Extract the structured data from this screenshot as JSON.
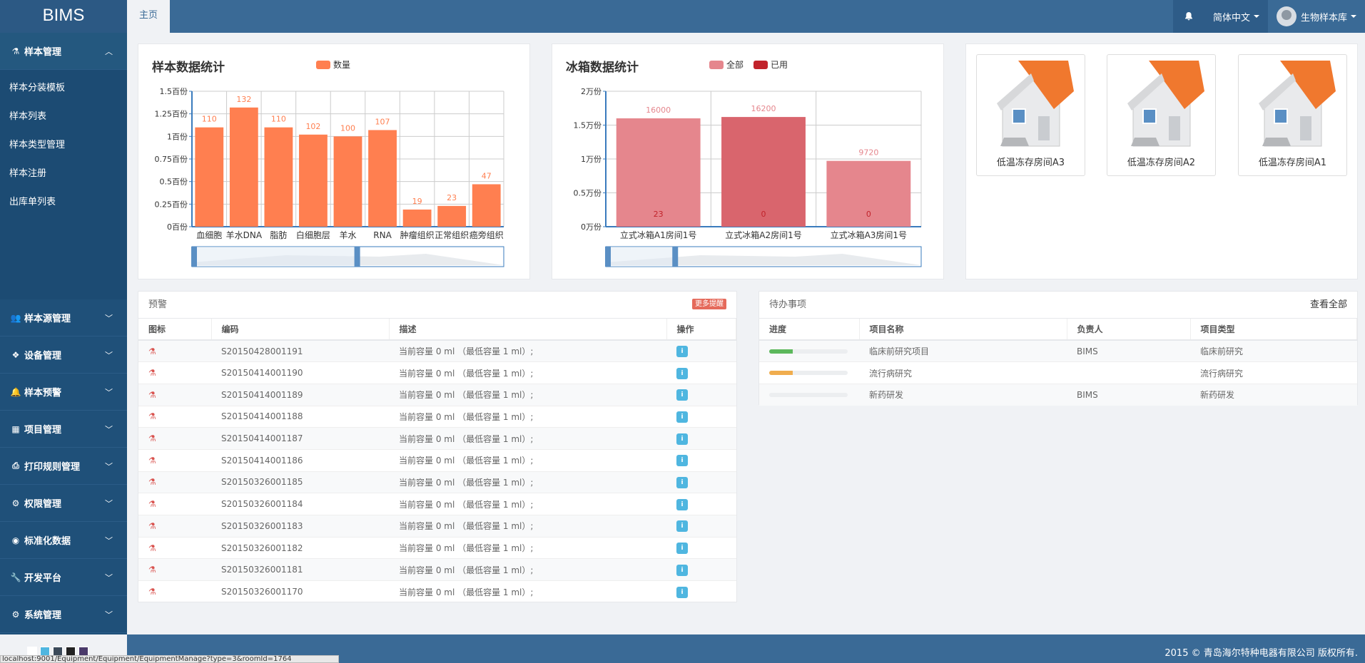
{
  "app": {
    "logo": "BIMS",
    "home_tab": "主页",
    "language": "简体中文",
    "user": "生物样本库",
    "footer": "2015 © 青岛海尔特种电器有限公司 版权所有."
  },
  "sidebar": {
    "open_menu": {
      "label": "样本管理",
      "icon": "flask-icon",
      "children": [
        "样本分装模板",
        "样本列表",
        "样本类型管理",
        "样本注册",
        "出库单列表"
      ]
    },
    "menus": [
      {
        "label": "样本源管理",
        "icon": "users-icon"
      },
      {
        "label": "设备管理",
        "icon": "dropbox-icon"
      },
      {
        "label": "样本预警",
        "icon": "bell-icon"
      },
      {
        "label": "项目管理",
        "icon": "table-icon"
      },
      {
        "label": "打印规则管理",
        "icon": "print-icon"
      },
      {
        "label": "权限管理",
        "icon": "gear-icon"
      },
      {
        "label": "标准化数据",
        "icon": "eye-icon"
      },
      {
        "label": "开发平台",
        "icon": "wrench-icon"
      },
      {
        "label": "系统管理",
        "icon": "cogs-icon"
      }
    ],
    "skins": [
      "#ffffff",
      "#4fb6e0",
      "#3c4a5a",
      "#222222",
      "#4a3a6a"
    ]
  },
  "status_url": "localhost:9001/Equipment/Equipment/EquipmentManage?type=3&roomId=1764",
  "sample_panel": {
    "title": "样本数据统计",
    "chart_data": {
      "type": "bar",
      "categories": [
        "血细胞",
        "羊水DNA",
        "脂肪",
        "白细胞层",
        "羊水",
        "RNA",
        "肿瘤组织",
        "正常组织",
        "癌旁组织"
      ],
      "series": [
        {
          "name": "数量",
          "values": [
            110,
            132,
            110,
            102,
            100,
            107,
            19,
            23,
            47
          ],
          "color": "#ff7f50"
        }
      ],
      "yticks": [
        "0百份",
        "0.25百份",
        "0.5百份",
        "0.75百份",
        "1百份",
        "1.25百份",
        "1.5百份"
      ],
      "ylim": [
        0,
        150
      ]
    }
  },
  "freezer_panel": {
    "title": "冰箱数据统计",
    "chart_data": {
      "type": "bar",
      "categories": [
        "立式冰箱A1房间1号",
        "立式冰箱A2房间1号",
        "立式冰箱A3房间1号"
      ],
      "series": [
        {
          "name": "全部",
          "values": [
            16000,
            16200,
            9720
          ],
          "color": "#e5868d"
        },
        {
          "name": "已用",
          "values": [
            23,
            0,
            0
          ],
          "color": "#c1232b"
        }
      ],
      "yticks": [
        "0万份",
        "0.5万份",
        "1万份",
        "1.5万份",
        "2万份"
      ],
      "ylim": [
        0,
        20000
      ]
    }
  },
  "rooms": [
    "低温冻存房间A3",
    "低温冻存房间A2",
    "低温冻存房间A1"
  ],
  "alerts": {
    "title": "预警",
    "more": "更多提醒",
    "columns": [
      "图标",
      "编码",
      "描述",
      "操作"
    ],
    "rows": [
      {
        "code": "S20150428001191",
        "desc": "当前容量 0 ml （最低容量 1 ml）;"
      },
      {
        "code": "S20150414001190",
        "desc": "当前容量 0 ml （最低容量 1 ml）;"
      },
      {
        "code": "S20150414001189",
        "desc": "当前容量 0 ml （最低容量 1 ml）;"
      },
      {
        "code": "S20150414001188",
        "desc": "当前容量 0 ml （最低容量 1 ml）;"
      },
      {
        "code": "S20150414001187",
        "desc": "当前容量 0 ml （最低容量 1 ml）;"
      },
      {
        "code": "S20150414001186",
        "desc": "当前容量 0 ml （最低容量 1 ml）;"
      },
      {
        "code": "S20150326001185",
        "desc": "当前容量 0 ml （最低容量 1 ml）;"
      },
      {
        "code": "S20150326001184",
        "desc": "当前容量 0 ml （最低容量 1 ml）;"
      },
      {
        "code": "S20150326001183",
        "desc": "当前容量 0 ml （最低容量 1 ml）;"
      },
      {
        "code": "S20150326001182",
        "desc": "当前容量 0 ml （最低容量 1 ml）;"
      },
      {
        "code": "S20150326001181",
        "desc": "当前容量 0 ml （最低容量 1 ml）;"
      },
      {
        "code": "S20150326001170",
        "desc": "当前容量 0 ml （最低容量 1 ml）;"
      }
    ]
  },
  "todo": {
    "title": "待办事项",
    "view_all": "查看全部",
    "columns": [
      "进度",
      "项目名称",
      "负责人",
      "项目类型"
    ],
    "rows": [
      {
        "progress": 0.3,
        "color": "#5cb85c",
        "name": "临床前研究项目",
        "owner": "BIMS",
        "type": "临床前研究"
      },
      {
        "progress": 0.3,
        "color": "#f0ad4e",
        "name": "流行病研究",
        "owner": "",
        "type": "流行病研究"
      },
      {
        "progress": 0,
        "color": "#5cb85c",
        "name": "新药研发",
        "owner": "BIMS",
        "type": "新药研发"
      }
    ]
  }
}
